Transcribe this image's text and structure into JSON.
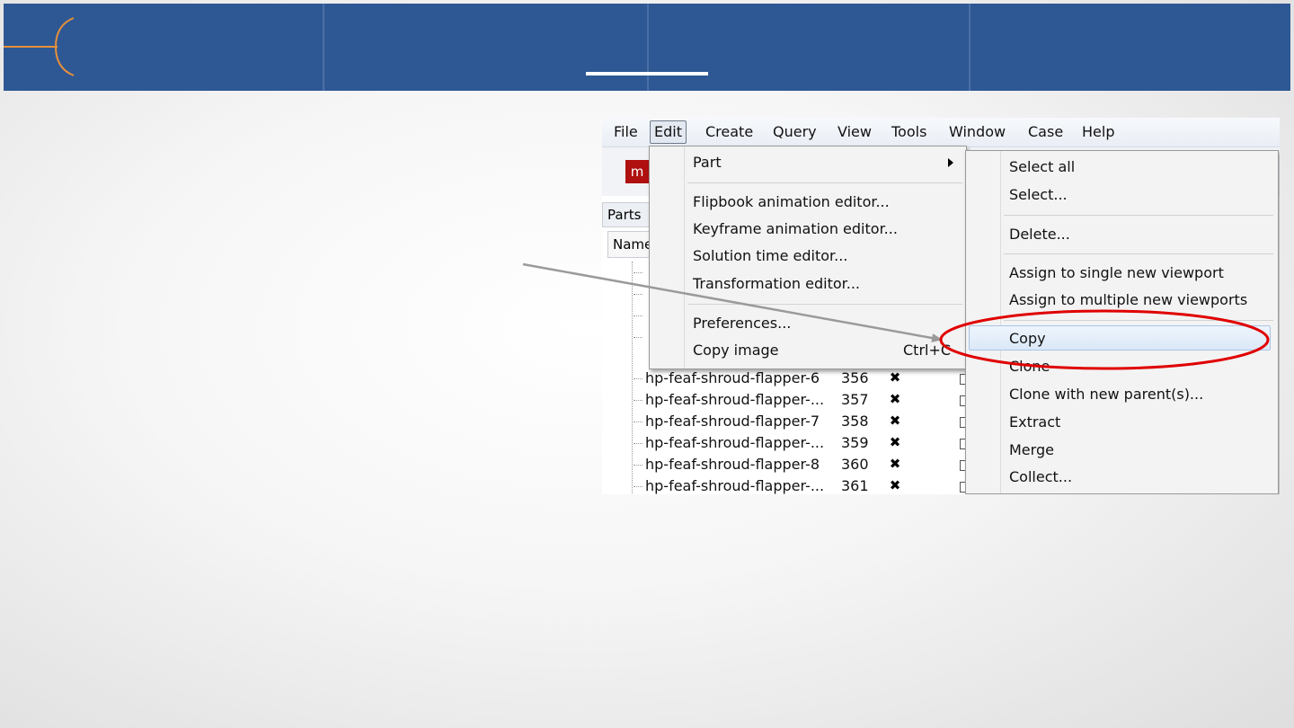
{
  "header": {
    "accent_color": "#e8903a",
    "band_color": "#2e5894"
  },
  "app": {
    "menubar": [
      "File",
      "Edit",
      "Create",
      "Query",
      "View",
      "Tools",
      "Window",
      "Case",
      "Help"
    ],
    "active_menu": "Edit",
    "icon_letter": "m",
    "parts_tab": "Parts",
    "name_column": "Name",
    "rows": [
      {
        "name": "hp-feaf-shroud-flapper-6",
        "id": "356"
      },
      {
        "name": "hp-feaf-shroud-flapper-...",
        "id": "357"
      },
      {
        "name": "hp-feaf-shroud-flapper-7",
        "id": "358"
      },
      {
        "name": "hp-feaf-shroud-flapper-...",
        "id": "359"
      },
      {
        "name": "hp-feaf-shroud-flapper-8",
        "id": "360"
      },
      {
        "name": "hp-feaf-shroud-flapper-...",
        "id": "361"
      }
    ]
  },
  "edit_menu": {
    "items": {
      "part": "Part",
      "flipbook": "Flipbook animation editor...",
      "keyframe": "Keyframe animation editor...",
      "solution_time": "Solution time editor...",
      "transformation": "Transformation editor...",
      "preferences": "Preferences...",
      "copy_image": "Copy image",
      "copy_image_shortcut": "Ctrl+C"
    }
  },
  "part_submenu": {
    "items": [
      "Select all",
      "Select...",
      "Delete...",
      "Assign to single new viewport",
      "Assign to multiple new viewports",
      "Copy",
      "Clone",
      "Clone with new parent(s)...",
      "Extract",
      "Merge",
      "Collect..."
    ],
    "highlighted": "Copy"
  },
  "annotation": {
    "ellipse_color": "#e00000",
    "arrow_color": "#9a9a9a"
  }
}
